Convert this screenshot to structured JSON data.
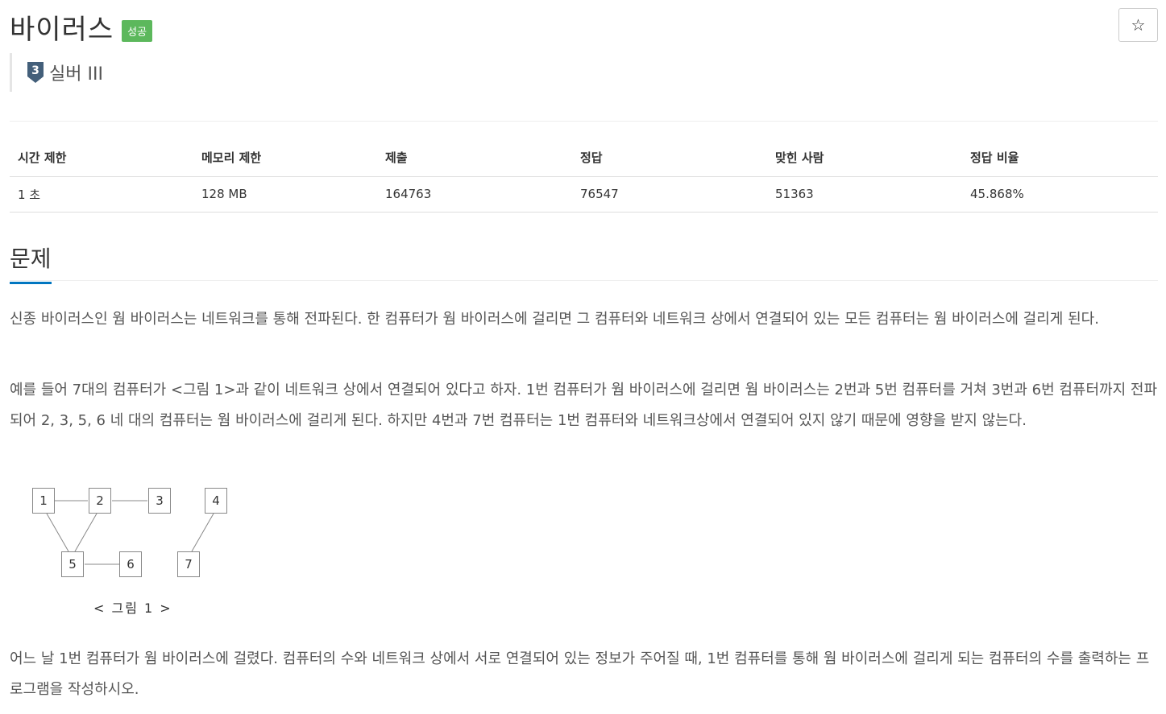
{
  "problem": {
    "title": "바이러스",
    "status_badge": "성공",
    "star_icon": "☆",
    "tier_number": "3",
    "tier_label": "실버 III",
    "tier_color": "#435f7a"
  },
  "stats": {
    "headers": [
      "시간 제한",
      "메모리 제한",
      "제출",
      "정답",
      "맞힌 사람",
      "정답 비율"
    ],
    "values": [
      "1 초",
      "128 MB",
      "164763",
      "76547",
      "51363",
      "45.868%"
    ]
  },
  "section": {
    "title": "문제",
    "accent_color": "#0076c0"
  },
  "description": {
    "p1": "신종 바이러스인 웜 바이러스는 네트워크를 통해 전파된다. 한 컴퓨터가 웜 바이러스에 걸리면 그 컴퓨터와 네트워크 상에서 연결되어 있는 모든 컴퓨터는 웜 바이러스에 걸리게 된다.",
    "p2": "예를 들어 7대의 컴퓨터가 <그림 1>과 같이 네트워크 상에서 연결되어 있다고 하자. 1번 컴퓨터가 웜 바이러스에 걸리면 웜 바이러스는 2번과 5번 컴퓨터를 거쳐 3번과 6번 컴퓨터까지 전파되어 2, 3, 5, 6 네 대의 컴퓨터는 웜 바이러스에 걸리게 된다. 하지만 4번과 7번 컴퓨터는 1번 컴퓨터와 네트워크상에서 연결되어 있지 않기 때문에 영향을 받지 않는다.",
    "p3": "어느 날 1번 컴퓨터가 웜 바이러스에 걸렸다. 컴퓨터의 수와 네트워크 상에서 서로 연결되어 있는 정보가 주어질 때, 1번 컴퓨터를 통해 웜 바이러스에 걸리게 되는 컴퓨터의 수를 출력하는 프로그램을 작성하시오."
  },
  "figure": {
    "nodes": [
      "1",
      "2",
      "3",
      "4",
      "5",
      "6",
      "7"
    ],
    "caption": "< 그림 1 >"
  }
}
